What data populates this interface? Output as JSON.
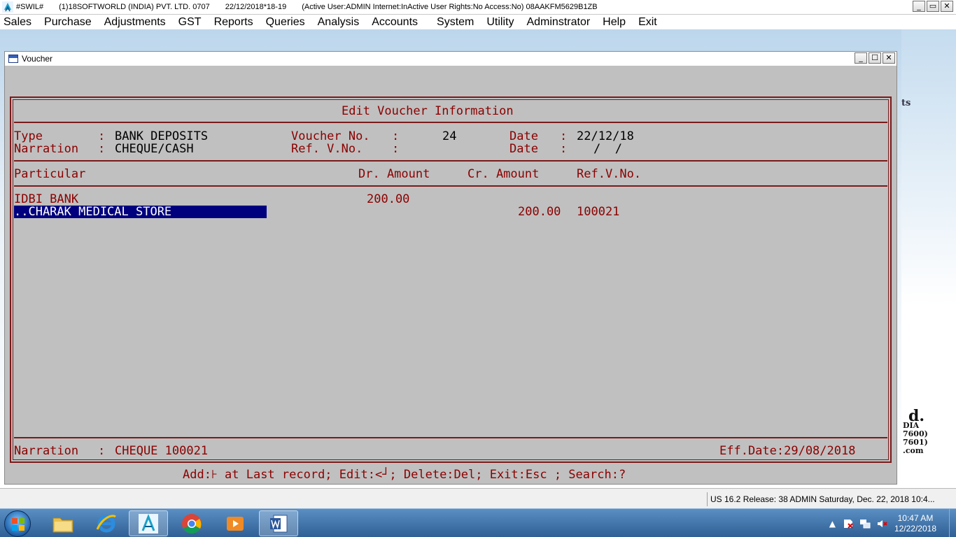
{
  "app": {
    "title_segments": [
      "#SWIL#",
      "(1)18SOFTWORLD (INDIA) PVT. LTD. 0707",
      "22/12/2018*18-19",
      "(Active User:ADMIN Internet:InActive User Rights:No Access:No) 08AAKFM5629B1ZB"
    ],
    "window_controls": {
      "minimize": "_",
      "restore": "▭",
      "close": "✕"
    }
  },
  "menu": [
    "Sales",
    "Purchase",
    "Adjustments",
    "GST",
    "Reports",
    "Queries",
    "Analysis",
    "Accounts",
    "System",
    "Utility",
    "Adminstrator",
    "Help",
    "Exit"
  ],
  "voucher_window": {
    "title": "Voucher",
    "controls": {
      "minimize": "_",
      "maximize": "☐",
      "close": "✕"
    }
  },
  "voucher": {
    "heading": "Edit Voucher Information",
    "type_label": "Type",
    "type_value": "BANK DEPOSITS",
    "narration_label": "Narration",
    "narration_value": "CHEQUE/CASH",
    "voucher_no_label": "Voucher No.",
    "voucher_no_value": "24",
    "ref_vno_label": "Ref. V.No.",
    "date_label": "Date",
    "date_value": "22/12/18",
    "ref_date_value": "/  /",
    "colon": ":",
    "columns": {
      "particular": "Particular",
      "dr_amount": "Dr. Amount",
      "cr_amount": "Cr. Amount",
      "ref_vno": "Ref.V.No."
    },
    "rows": [
      {
        "particular": "IDBI BANK",
        "dr": "200.00",
        "cr": "",
        "ref": ""
      },
      {
        "particular": "..CHARAK MEDICAL STORE",
        "dr": "",
        "cr": "200.00",
        "ref": "100021",
        "selected": true
      }
    ],
    "footer_narration_label": "Narration",
    "footer_narration_value": "CHEQUE 100021",
    "eff_date": "Eff.Date:29/08/2018",
    "help_line": "Add:⊦ at Last record; Edit:<┘; Delete:Del; Exit:Esc ; Search:?"
  },
  "desktop_brand": {
    "ts": "ts",
    "big": "d.",
    "lines": [
      "DIA",
      "7600)",
      "7601)",
      ".com"
    ]
  },
  "statusbar": {
    "info": "US 16.2 Release: 38  ADMIN  Saturday, Dec. 22, 2018  10:4..."
  },
  "taskbar": {
    "apps": [
      "file-explorer",
      "internet-explorer",
      "swil",
      "chrome",
      "media-player",
      "word"
    ],
    "tray": {
      "expand": "▲",
      "clock_time": "10:47 AM",
      "clock_date": "12/22/2018"
    }
  },
  "colors": {
    "accent_text": "#8b0000",
    "selection": "#00007f",
    "window_bg": "#c0c0c0"
  }
}
